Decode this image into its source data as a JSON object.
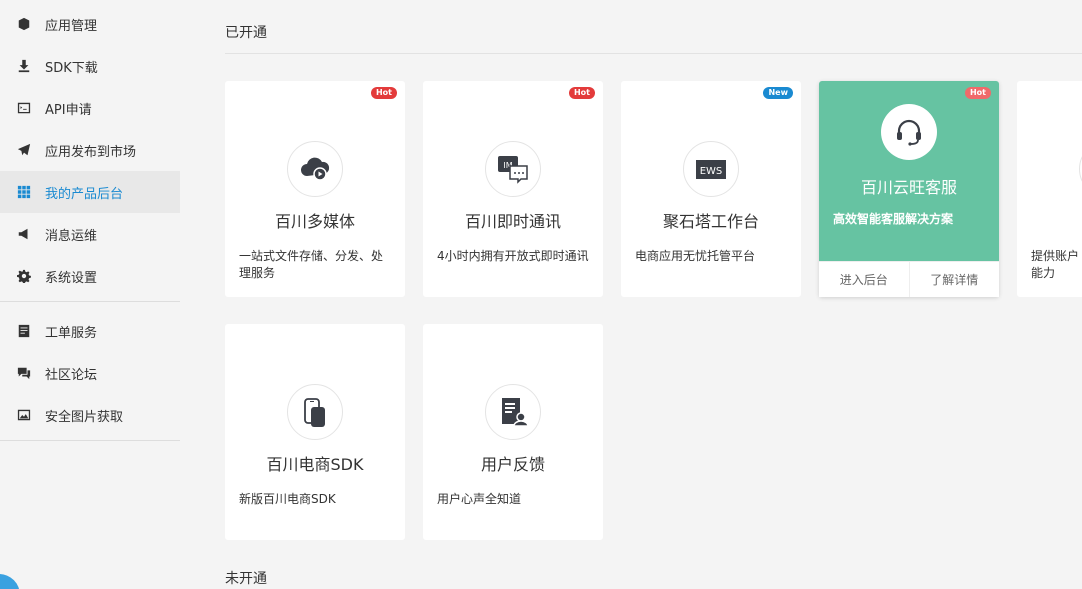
{
  "sidebar": {
    "group1": [
      {
        "label": "应用管理",
        "icon": "cube-icon"
      },
      {
        "label": "SDK下载",
        "icon": "download-icon"
      },
      {
        "label": "API申请",
        "icon": "terminal-icon"
      },
      {
        "label": "应用发布到市场",
        "icon": "paper-plane-icon"
      },
      {
        "label": "我的产品后台",
        "icon": "grid-icon",
        "active": true
      },
      {
        "label": "消息运维",
        "icon": "megaphone-icon"
      },
      {
        "label": "系统设置",
        "icon": "gear-icon"
      }
    ],
    "group2": [
      {
        "label": "工单服务",
        "icon": "document-icon"
      },
      {
        "label": "社区论坛",
        "icon": "chat-icon"
      },
      {
        "label": "安全图片获取",
        "icon": "image-icon"
      }
    ]
  },
  "sections": {
    "opened": "已开通",
    "closed": "未开通"
  },
  "cards": [
    {
      "name": "百川多媒体",
      "desc": "一站式文件存储、分发、处理服务",
      "badge": "Hot",
      "icon": "cloud-play-icon"
    },
    {
      "name": "百川即时通讯",
      "desc": "4小时内拥有开放式即时通讯",
      "badge": "Hot",
      "icon": "im-chat-icon"
    },
    {
      "name": "聚石塔工作台",
      "desc": "电商应用无忧托管平台",
      "badge": "New",
      "icon": "ews-icon"
    },
    {
      "name": "百川云旺客服",
      "desc": "高效智能客服解决方案",
      "badge": "Hot",
      "icon": "headset-icon",
      "actions": [
        "进入后台",
        "了解详情"
      ]
    },
    {
      "name": "",
      "desc": "提供账户",
      "desc2": "能力"
    },
    {
      "name": "百川电商SDK",
      "desc": "新版百川电商SDK",
      "icon": "phone-icon"
    },
    {
      "name": "用户反馈",
      "desc": "用户心声全知道",
      "icon": "feedback-icon"
    }
  ],
  "colors": {
    "accent": "#1a8ad1",
    "featured": "#66c3a2",
    "hot": "#e33b3b",
    "new": "#1a8ad1"
  }
}
